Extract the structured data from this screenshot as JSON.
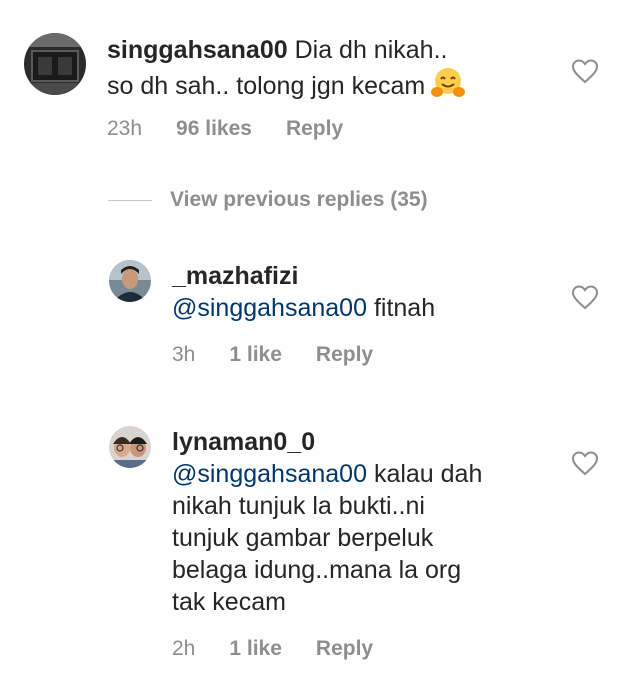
{
  "comments": [
    {
      "username": "singgahsana00",
      "text_line1": "Dia dh nikah..",
      "text_line2": "so dh sah.. tolong jgn kecam",
      "emoji": "hugging-face-emoji",
      "time": "23h",
      "likes": "96 likes",
      "reply": "Reply"
    }
  ],
  "view_previous": "View previous replies (35)",
  "replies": [
    {
      "username": "_mazhafizi",
      "mention": "@singgahsana00",
      "text": "fitnah",
      "time": "3h",
      "likes": "1 like",
      "reply": "Reply"
    },
    {
      "username": "lynaman0_0",
      "mention": "@singgahsana00",
      "text_line1": "kalau dah",
      "text_line2": "nikah tunjuk la bukti..ni",
      "text_line3": "tunjuk gambar berpeluk",
      "text_line4": "belaga idung..mana la org",
      "text_line5": "tak kecam",
      "time": "2h",
      "likes": "1 like",
      "reply": "Reply"
    }
  ],
  "colors": {
    "mention": "#00376b",
    "meta": "#8e8e8e",
    "text": "#262626"
  }
}
